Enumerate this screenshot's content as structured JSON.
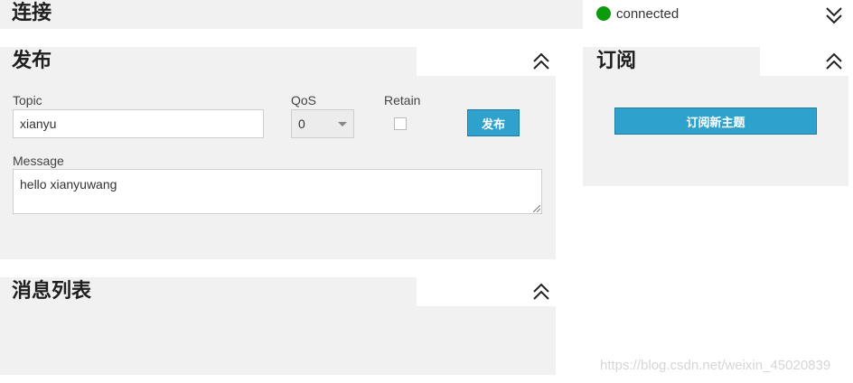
{
  "connection": {
    "title": "连接",
    "status_text": "connected",
    "status_color": "#0d9b0d",
    "toggle_icon": "chevron-double-down-icon"
  },
  "publish": {
    "title": "发布",
    "toggle_icon": "chevron-double-up-icon",
    "topic_label": "Topic",
    "topic_value": "xianyu",
    "qos_label": "QoS",
    "qos_value": "0",
    "retain_label": "Retain",
    "retain_checked": false,
    "button_label": "发布",
    "message_label": "Message",
    "message_value": "hello xianyuwang"
  },
  "subscribe": {
    "title": "订阅",
    "toggle_icon": "chevron-double-up-icon",
    "button_label": "订阅新主题"
  },
  "messages": {
    "title": "消息列表",
    "toggle_icon": "chevron-double-up-icon"
  },
  "watermark": "https://blog.csdn.net/weixin_45020839",
  "colors": {
    "panel_bg": "#f1f1f1",
    "button_bg": "#2ea1cd"
  }
}
